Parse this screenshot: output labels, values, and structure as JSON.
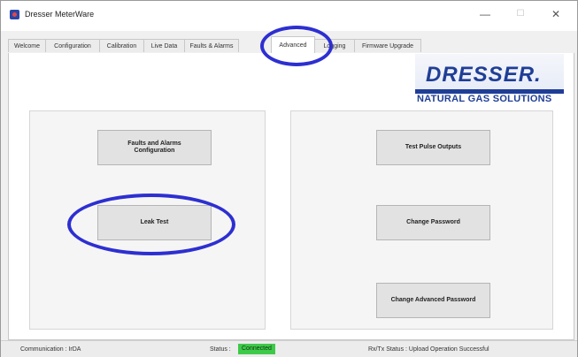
{
  "window": {
    "title": "Dresser MeterWare",
    "minimize_glyph": "—",
    "maximize_glyph": "☐",
    "close_glyph": "✕"
  },
  "tabs": [
    {
      "label": "Welcome",
      "active": false
    },
    {
      "label": "Configuration",
      "active": false
    },
    {
      "label": "Calibration",
      "active": false
    },
    {
      "label": "Live Data",
      "active": false
    },
    {
      "label": "Faults & Alarms",
      "active": false
    },
    {
      "label": "Advanced",
      "active": true
    },
    {
      "label": "Logging",
      "active": false
    },
    {
      "label": "Firmware Upgrade",
      "active": false
    }
  ],
  "logo": {
    "name": "DRESSER.",
    "subtitle": "NATURAL GAS SOLUTIONS"
  },
  "left_panel": {
    "faults_button": "Faults and Alarms\nConfiguration",
    "leak_button": "Leak Test"
  },
  "right_panel": {
    "pulse_button": "Test Pulse Outputs",
    "password_button": "Change Password",
    "adv_password_button": "Change Advanced Password"
  },
  "status": {
    "communication": "Communication : IrDA",
    "status_label": "Status :",
    "status_value": "Connected",
    "rxtx": "Rx/Tx Status : Upload Operation Successful"
  },
  "colors": {
    "annotation": "#2d2fd1",
    "brand": "#1f3e96",
    "connected": "#3fc94a"
  }
}
